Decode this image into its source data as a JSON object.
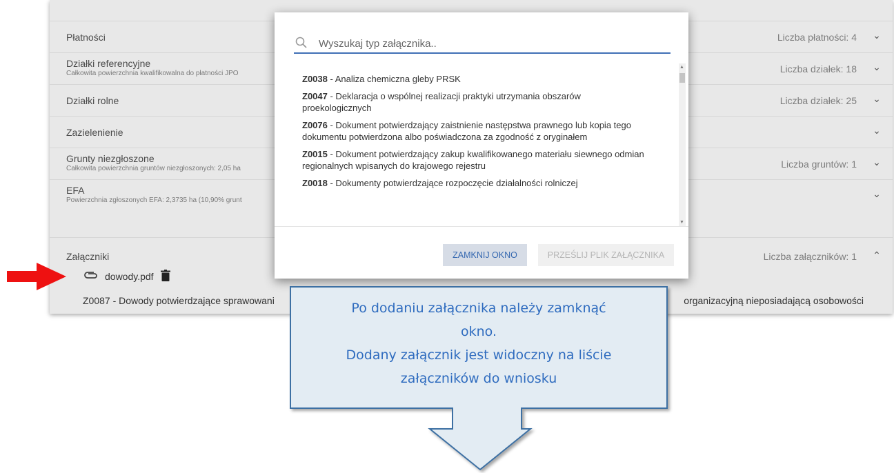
{
  "sections": [
    {
      "title": "Płatności",
      "subtitle": "",
      "count": "Liczba płatności: 4"
    },
    {
      "title": "Działki referencyjne",
      "subtitle": "Całkowita powierzchnia kwalifikowalna do płatności JPO",
      "count": "Liczba działek: 18"
    },
    {
      "title": "Działki rolne",
      "subtitle": "",
      "count": "Liczba działek: 25"
    },
    {
      "title": "Zazielenienie",
      "subtitle": "",
      "count": ""
    },
    {
      "title": "Grunty niezgłoszone",
      "subtitle": "Całkowita powierzchnia gruntów niezgłoszonych: 2,05 ha",
      "count": "Liczba gruntów: 1"
    },
    {
      "title": "EFA",
      "subtitle": "Powierzchnia zgłoszonych EFA: 2,3735 ha (10,90% grunt",
      "count": ""
    }
  ],
  "attachments": {
    "title": "Załączniki",
    "count": "Liczba załączników: 1",
    "file_name": "dowody.pdf",
    "description_left": "Z0087 - Dowody potwierdzające sprawowani",
    "description_right": "organizacyjną nieposiadającą osobowości"
  },
  "modal": {
    "search_placeholder": "Wyszukaj typ załącznika..",
    "items": [
      {
        "code": "Z0038",
        "text": " - Analiza chemiczna gleby PRSK"
      },
      {
        "code": "Z0047",
        "text": " - Deklaracja o wspólnej realizacji praktyki utrzymania obszarów proekologicznych"
      },
      {
        "code": "Z0076",
        "text": " - Dokument potwierdzający zaistnienie następstwa prawnego lub kopia tego dokumentu potwierdzona albo poświadczona za zgodność z oryginałem"
      },
      {
        "code": "Z0015",
        "text": " - Dokument potwierdzający zakup kwalifikowanego materiału siewnego odmian regionalnych wpisanych do krajowego rejestru"
      },
      {
        "code": "Z0018",
        "text": " - Dokumenty potwierdzające rozpoczęcie działalności rolniczej"
      }
    ],
    "close_button": "ZAMKNIJ OKNO",
    "upload_button": "PRZEŚLIJ PLIK ZAŁĄCZNIKA"
  },
  "callout": {
    "lines": [
      "Po dodaniu załącznika należy zamknąć",
      "okno.",
      "Dodany załącznik jest widoczny na liście",
      "załączników do wniosku"
    ]
  },
  "colors": {
    "accent": "#3f6fb5",
    "callout_fill": "#e3ecf3",
    "callout_border": "#3d6fa3",
    "arrow_red": "#ee1111"
  }
}
